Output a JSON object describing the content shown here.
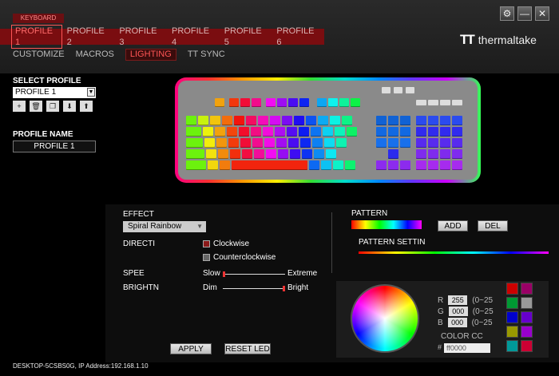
{
  "app": {
    "tag": "KEYBOARD",
    "logo_text": "thermaltake",
    "logo_mark": "TT"
  },
  "window": {
    "settings_glyph": "⚙",
    "minimize_glyph": "—",
    "close_glyph": "✕"
  },
  "profile_tabs": [
    "PROFILE 1",
    "PROFILE 2",
    "PROFILE 3",
    "PROFILE 4",
    "PROFILE 5",
    "PROFILE 6"
  ],
  "sub_tabs": [
    "CUSTOMIZE",
    "MACROS",
    "LIGHTING",
    "TT SYNC"
  ],
  "left": {
    "select_label": "SELECT PROFILE",
    "selected_profile": "PROFILE 1",
    "dropdown_glyph": "▼",
    "icons": [
      {
        "name": "add-icon",
        "glyph": "+"
      },
      {
        "name": "trash-icon",
        "glyph": "🗑"
      },
      {
        "name": "copy-icon",
        "glyph": "❐"
      },
      {
        "name": "import-icon",
        "glyph": "⬇"
      },
      {
        "name": "export-icon",
        "glyph": "⬆"
      }
    ],
    "name_label": "PROFILE NAME",
    "name_value": "PROFILE 1"
  },
  "lighting": {
    "effect_label": "EFFECT",
    "effect_value": "Spiral Rainbow",
    "effect_glyph": "▼",
    "direction_label": "DIRECTI",
    "direction_options": [
      "Clockwise",
      "Counterclockwise"
    ],
    "selected_direction": "Clockwise",
    "speed_label": "SPEE",
    "speed_min": "Slow",
    "speed_max": "Extreme",
    "speed_level": 0.0,
    "brightness_label": "BRIGHTN",
    "brightness_min": "Dim",
    "brightness_max": "Bright",
    "brightness_level": 1.0,
    "apply_label": "APPLY",
    "reset_label": "RESET LED"
  },
  "pattern": {
    "label": "PATTERN",
    "add_label": "ADD",
    "del_label": "DEL",
    "settings_label": "PATTERN SETTIN"
  },
  "color": {
    "r_label": "R",
    "r_value": "255",
    "r_range": "(0~25",
    "g_label": "G",
    "g_value": "000",
    "g_range": "(0~25",
    "b_label": "B",
    "b_value": "000",
    "b_range": "(0~25",
    "code_label": "COLOR CC",
    "hash": "#",
    "hex_value": "ff0000",
    "swatches": [
      "#cc0000",
      "#990066",
      "#009933",
      "#999999",
      "#0000cc",
      "#6600cc",
      "#999900",
      "#9900cc",
      "#009999",
      "#cc0033"
    ]
  },
  "status_bar": "DESKTOP-5CSBS0G, IP Address:192.168.1.10"
}
